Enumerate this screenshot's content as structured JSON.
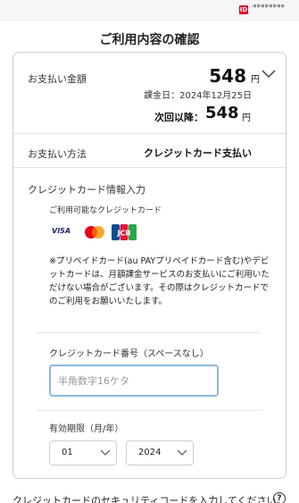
{
  "header": {
    "id_badge": "ID",
    "masked_user": "********"
  },
  "page": {
    "title": "ご利用内容の確認"
  },
  "billing": {
    "amount_label": "お支払い金額",
    "amount_value": "548",
    "amount_unit": "円",
    "billing_date": "課金日：2024年12月25日",
    "next_label": "次回以降：",
    "next_value": "548",
    "next_unit": "円"
  },
  "payment": {
    "method_label": "お支払い方法",
    "method_value": "クレジットカード支払い"
  },
  "credit_card": {
    "heading": "クレジットカード情報入力",
    "available_label": "ご利用可能なクレジットカード",
    "brands": {
      "visa": "VISA",
      "jcb": "JCB"
    },
    "note": "※プリペイドカード(au PAYプリペイドカード含む)やデビットカードは、月額課金サービスのお支払いにご利用いただけない場合がございます。その際はクレジットカードでのご利用をお願いいたします。",
    "number_label": "クレジットカード番号（スペースなし）",
    "number_placeholder": "半角数字16ケタ",
    "number_value": "",
    "expiry_label": "有効期限（月/年）",
    "expiry_month": "01",
    "expiry_year": "2024"
  },
  "footer": {
    "cut_text": "クレジットカードのセキュリティコードを入力してください。",
    "help_symbol": "?"
  },
  "colors": {
    "input_focus_border": "#8ab8e0",
    "card_border": "#cfcfcf",
    "id_badge_bg": "#e0002b"
  }
}
